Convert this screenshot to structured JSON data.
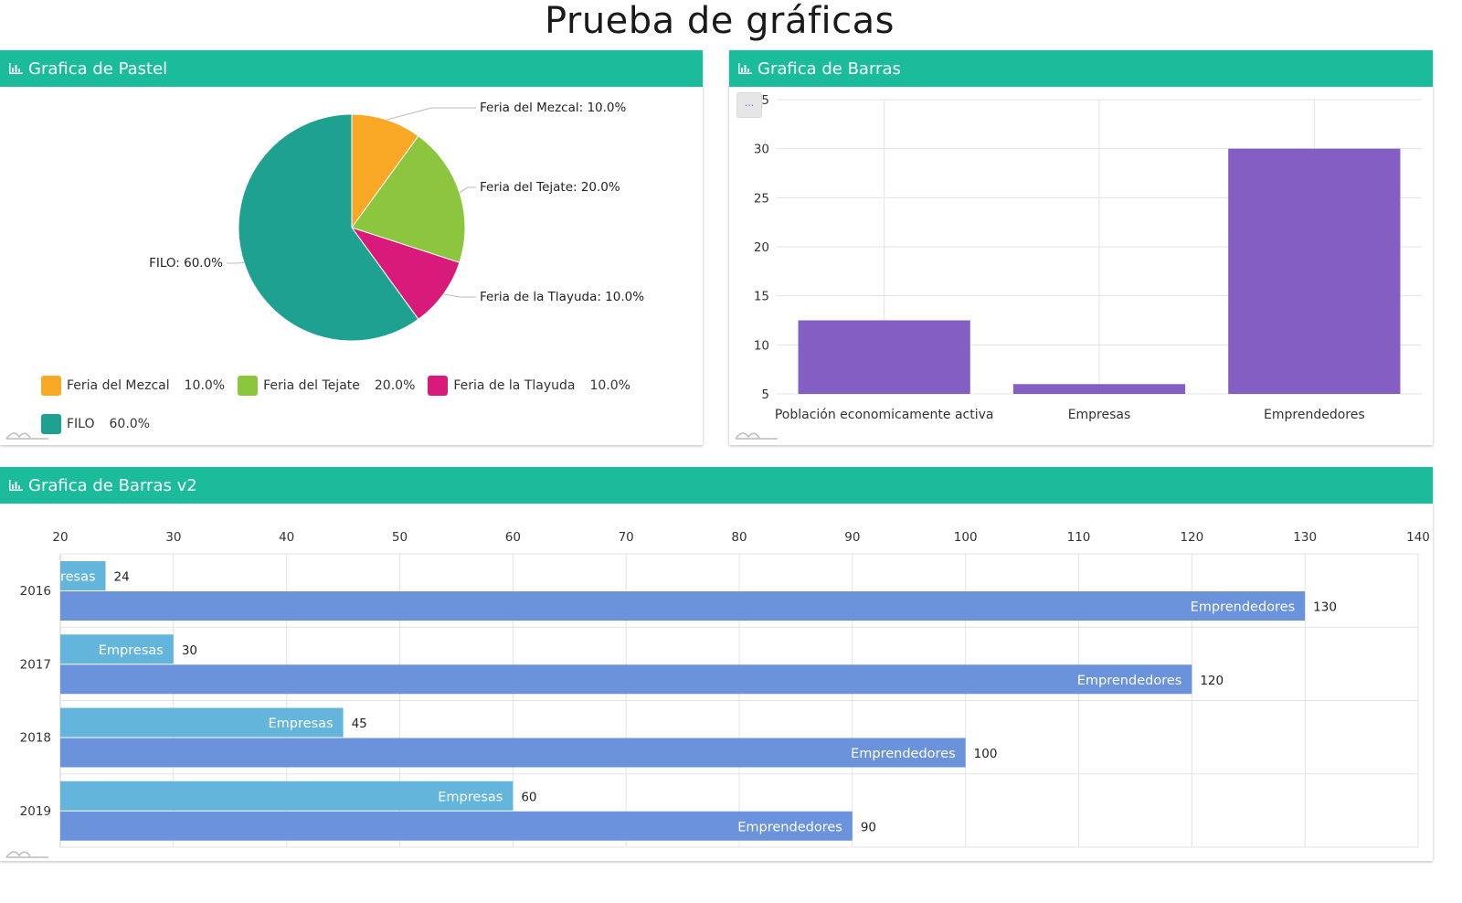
{
  "page_title": "Prueba de gráficas",
  "panels": {
    "pie": {
      "title": "Grafica de Pastel"
    },
    "bar": {
      "title": "Grafica de Barras",
      "menu_label": "..."
    },
    "hbar": {
      "title": "Grafica de Barras v2"
    }
  },
  "icons": {
    "chart": "bar-chart-icon",
    "logo": "chart-logo-icon",
    "menu": "menu-icon"
  },
  "chart_data": [
    {
      "type": "pie",
      "title": "Grafica de Pastel",
      "slices": [
        {
          "label": "Feria del Mezcal",
          "value": 10.0,
          "display": "10.0%",
          "color": "#f9a825"
        },
        {
          "label": "Feria del Tejate",
          "value": 20.0,
          "display": "20.0%",
          "color": "#8cc63f"
        },
        {
          "label": "Feria de la Tlayuda",
          "value": 10.0,
          "display": "10.0%",
          "color": "#d81b7a"
        },
        {
          "label": "FILO",
          "value": 60.0,
          "display": "60.0%",
          "color": "#1fa191"
        }
      ],
      "legend_placement": "bottom"
    },
    {
      "type": "bar",
      "title": "Grafica de Barras",
      "categories": [
        "Población economicamente activa",
        "Empresas",
        "Emprendedores"
      ],
      "values": [
        12.5,
        6,
        30
      ],
      "color": "#845ec2",
      "ylim": [
        5,
        35
      ],
      "yticks": [
        5,
        10,
        15,
        20,
        25,
        30,
        35
      ],
      "grid": true
    },
    {
      "type": "bar",
      "orientation": "horizontal",
      "title": "Grafica de Barras v2",
      "categories": [
        "2016",
        "2017",
        "2018",
        "2019"
      ],
      "series": [
        {
          "name": "Empresas",
          "values": [
            24,
            30,
            45,
            60
          ],
          "color": "#64b5dc"
        },
        {
          "name": "Emprendedores",
          "values": [
            130,
            120,
            100,
            90
          ],
          "color": "#6a93dc"
        }
      ],
      "xlim": [
        20,
        140
      ],
      "xticks": [
        20,
        30,
        40,
        50,
        60,
        70,
        80,
        90,
        100,
        110,
        120,
        130,
        140
      ],
      "grid": true
    }
  ]
}
